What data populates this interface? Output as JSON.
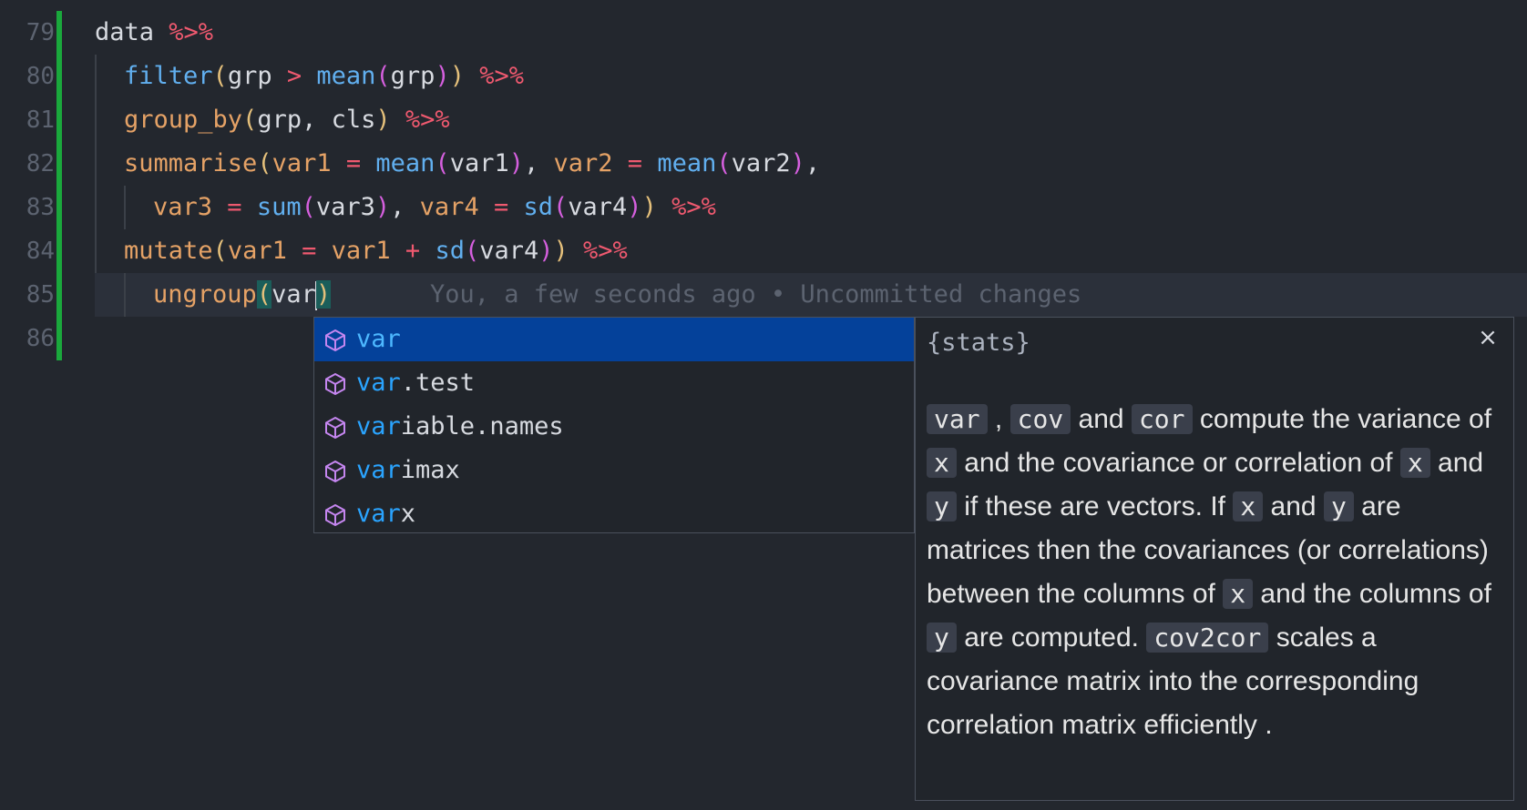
{
  "gutter": {
    "line_numbers": [
      "79",
      "80",
      "81",
      "82",
      "83",
      "84",
      "85",
      "86"
    ]
  },
  "code": {
    "l79": {
      "a": "data ",
      "b": "%>%"
    },
    "l80": {
      "fn": "filter",
      "p1": "(",
      "a": "grp ",
      "op": ">",
      "sp": " ",
      "fn2": "mean",
      "p2": "(",
      "b": "grp",
      "p3": ")",
      "p4": ")",
      "tail": " ",
      "pipe": "%>%"
    },
    "l81": {
      "fn": "group_by",
      "p1": "(",
      "a": "grp, cls",
      "p2": ")",
      "sp": " ",
      "pipe": "%>%"
    },
    "l82": {
      "fn": "summarise",
      "p1": "(",
      "v1": "var1",
      "eq1": " = ",
      "fn2": "mean",
      "p2": "(",
      "a1": "var1",
      "p3": ")",
      "c1": ", ",
      "v2": "var2",
      "eq2": " = ",
      "fn3": "mean",
      "p4": "(",
      "a2": "var2",
      "p5": ")",
      "c2": ","
    },
    "l83": {
      "v3": "var3",
      "eq1": " = ",
      "fn1": "sum",
      "p1": "(",
      "a1": "var3",
      "p2": ")",
      "c1": ", ",
      "v4": "var4",
      "eq2": " = ",
      "fn2": "sd",
      "p3": "(",
      "a2": "var4",
      "p4": ")",
      "p5": ")",
      "sp": " ",
      "pipe": "%>%"
    },
    "l84": {
      "fn": "mutate",
      "p1": "(",
      "v1": "var1",
      "eq": " = ",
      "a1": "var1",
      "plus": " + ",
      "fn2": "sd",
      "p2": "(",
      "a2": "var4",
      "p3": ")",
      "p4": ")",
      "sp": " ",
      "pipe": "%>%"
    },
    "l85": {
      "fn": "ungroup",
      "p1": "(",
      "typed": "var",
      "p2": ")"
    }
  },
  "blame": "You, a few seconds ago • Uncommitted changes",
  "suggest": {
    "items": [
      {
        "match": "var",
        "rest": ""
      },
      {
        "match": "var",
        "rest": ".test"
      },
      {
        "match": "var",
        "rest": "iable.names"
      },
      {
        "match": "var",
        "rest": "imax"
      },
      {
        "match": "var",
        "rest": "x"
      }
    ],
    "selected_index": 0
  },
  "docs": {
    "package": "{stats}",
    "close": "×",
    "t_var": "var",
    "t_sep1": ",",
    "t_cov": "cov",
    "t_and1": "and",
    "t_cor": "cor",
    "t_compute": "compute the variance of",
    "t_x1": "x",
    "t_cov_or": "and the covariance or correlation of",
    "t_x2": "x",
    "t_and2": "and",
    "t_y1": "y",
    "t_if_vec": "if these are vectors. If",
    "t_x3": "x",
    "t_and3": "and",
    "t_y2": "y",
    "t_matrices": "are matrices then the covariances (or correlations) between the columns of",
    "t_x4": "x",
    "t_and_cols": "and the columns of",
    "t_y3": "y",
    "t_are_comp": "are computed.",
    "t_cov2cor": "cov2cor",
    "t_scales": "scales a covariance matrix into the corresponding correlation matrix efficiently ."
  },
  "colors": {
    "background": "#23272e",
    "git_added": "#1aa83c",
    "selection": "#04419a",
    "match": "#2aa4ff",
    "pipe_operator": "#ef596f",
    "function_orange": "#e5a266",
    "function_blue": "#61afef"
  }
}
